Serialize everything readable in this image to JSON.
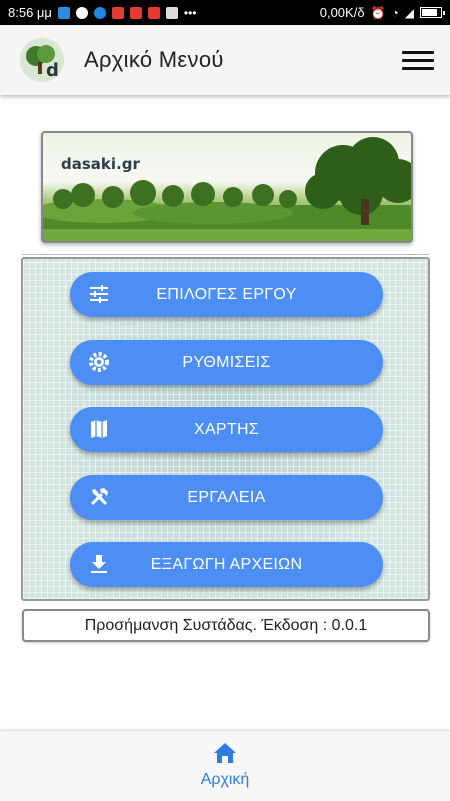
{
  "status_bar": {
    "time": "8:56 μμ",
    "network_speed": "0,00K/δ"
  },
  "app_bar": {
    "title": "Αρχικό Μενού",
    "logo_icon": "forest-logo-icon",
    "menu_icon": "hamburger-menu-icon"
  },
  "banner": {
    "text": "dasaki.gr"
  },
  "menu": {
    "items": [
      {
        "label": "ΕΠΙΛΟΓΕΣ ΕΡΓΟΥ",
        "icon": "tune-icon"
      },
      {
        "label": "ΡΥΘΜΙΣΕΙΣ",
        "icon": "gear-icon"
      },
      {
        "label": "ΧΑΡΤΗΣ",
        "icon": "map-icon"
      },
      {
        "label": "ΕΡΓΑΛΕΙΑ",
        "icon": "tools-icon"
      },
      {
        "label": "ΕΞΑΓΩΓΗ ΑΡΧΕΙΩΝ",
        "icon": "download-icon"
      }
    ]
  },
  "version": {
    "text": "Προσήμανση Συστάδας. Έκδοση : 0.0.1"
  },
  "bottom_nav": {
    "items": [
      {
        "label": "Αρχική",
        "icon": "home-icon",
        "active": true
      }
    ]
  },
  "colors": {
    "accent": "#4d8ef5",
    "nav_active": "#2f7de0",
    "app_bar": "#f5f5f5"
  }
}
